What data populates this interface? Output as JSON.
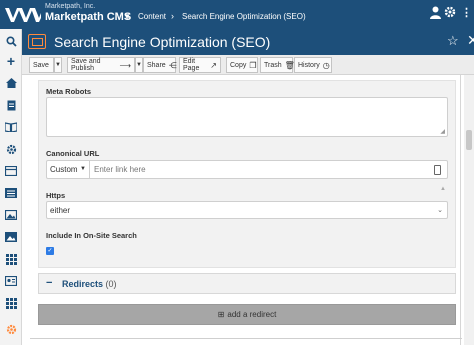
{
  "topbar": {
    "brand_small": "Marketpath, Inc.",
    "brand_big": "Marketpath CMS",
    "crumb_1": "Content",
    "crumb_2": "Search Engine Optimization (SEO)",
    "sep": "›"
  },
  "titlebar": {
    "title": "Search Engine Optimization (SEO)"
  },
  "toolbar": {
    "save": "Save",
    "save_publish": "Save and Publish",
    "share": "Share",
    "edit_page": "Edit Page",
    "copy": "Copy",
    "trash": "Trash",
    "history": "History"
  },
  "form": {
    "meta_robots_label": "Meta Robots",
    "canonical_label": "Canonical URL",
    "canonical_type": "Custom",
    "canonical_placeholder": "Enter link here",
    "https_label": "Https",
    "https_value": "either",
    "onsite_label": "Include In On-Site Search"
  },
  "redirects": {
    "title": "Redirects",
    "count": "(0)",
    "add_label": "add a redirect"
  },
  "colors": {
    "primary": "#1d4f7a",
    "accent": "#ff8a3d",
    "checkbox": "#2d7be5"
  }
}
